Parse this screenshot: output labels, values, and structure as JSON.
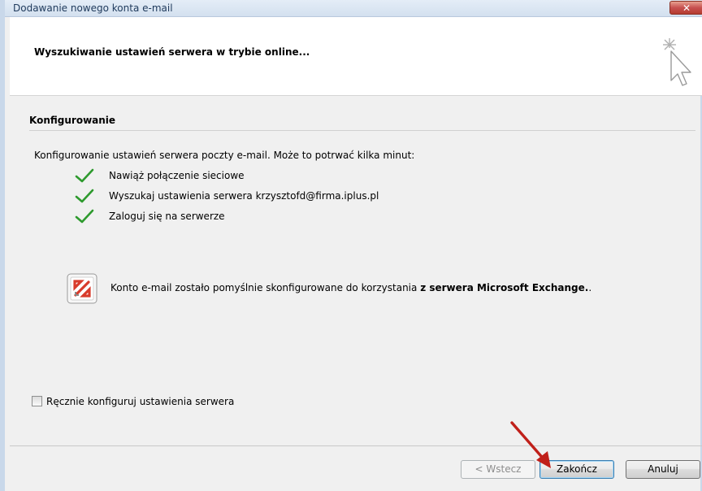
{
  "window": {
    "title": "Dodawanie nowego konta e-mail",
    "close_label": "✕"
  },
  "header": {
    "title": "Wyszukiwanie ustawień serwera w trybie online..."
  },
  "section": {
    "title": "Konfigurowanie"
  },
  "intro": "Konfigurowanie ustawień serwera poczty e-mail. Może to potrwać kilka minut:",
  "steps": [
    {
      "label": "Nawiąż połączenie sieciowe",
      "status": "done"
    },
    {
      "label": "Wyszukaj ustawienia serwera krzysztofd@firma.iplus.pl",
      "status": "done"
    },
    {
      "label": "Zaloguj się na serwerze",
      "status": "done"
    }
  ],
  "result": {
    "text_prefix": "Konto e-mail zostało pomyślnie skonfigurowane do korzystania ",
    "text_bold": "z serwera Microsoft Exchange.",
    "text_suffix": "."
  },
  "manual_config": {
    "label": "Ręcznie konfiguruj ustawienia serwera",
    "checked": false
  },
  "buttons": {
    "back": "< Wstecz",
    "finish": "Zakończ",
    "cancel": "Anuluj"
  },
  "colors": {
    "check": "#2e9a2e",
    "arrow": "#c0201a",
    "exchange_red": "#d83b2b"
  }
}
